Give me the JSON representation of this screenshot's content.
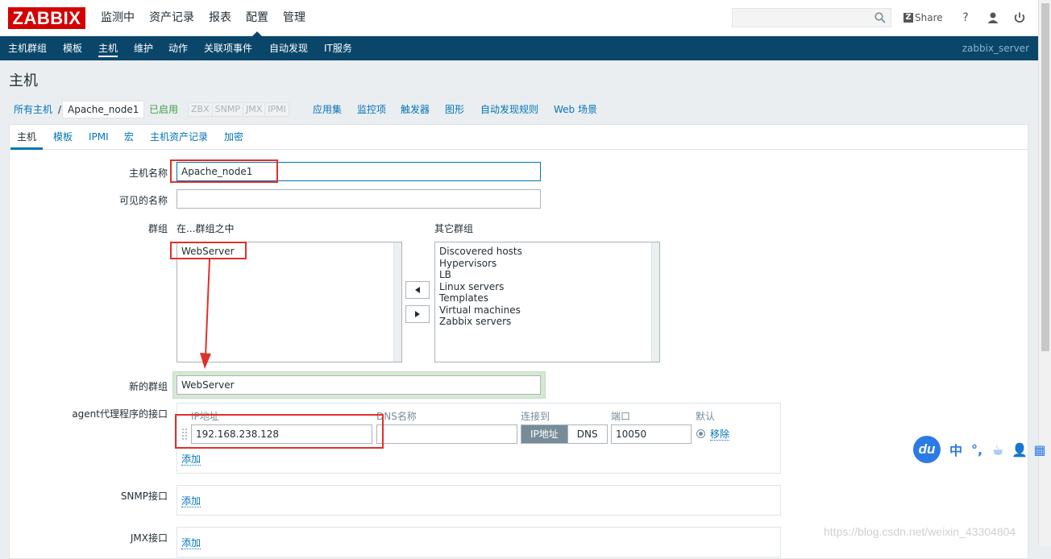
{
  "logo": "ZABBIX",
  "main_menu": [
    "监测中",
    "资产记录",
    "报表",
    "配置",
    "管理"
  ],
  "main_menu_active": "配置",
  "search": {
    "value": "",
    "placeholder": ""
  },
  "header_tools": {
    "share": "Share",
    "help": "?"
  },
  "sub_menu": [
    "主机群组",
    "模板",
    "主机",
    "维护",
    "动作",
    "关联项事件",
    "自动发现",
    "IT服务"
  ],
  "sub_menu_active": "主机",
  "server_name": "zabbix_server",
  "page_title": "主机",
  "breadcrumb": {
    "all_hosts": "所有主机",
    "separator": "/",
    "current": "Apache_node1",
    "status": "已启用",
    "availability": [
      "ZBX",
      "SNMP",
      "JMX",
      "IPMI"
    ],
    "links": [
      "应用集",
      "监控项",
      "触发器",
      "图形",
      "自动发现规则",
      "Web 场景"
    ]
  },
  "tabs": [
    "主机",
    "模板",
    "IPMI",
    "宏",
    "主机资产记录",
    "加密"
  ],
  "tab_active": "主机",
  "form": {
    "host_name_label": "主机名称",
    "host_name_value": "Apache_node1",
    "visible_name_label": "可见的名称",
    "visible_name_value": "",
    "groups_label": "群组",
    "in_groups_label": "在...群组之中",
    "other_groups_label": "其它群组",
    "in_groups": [
      "WebServer"
    ],
    "other_groups": [
      "Discovered hosts",
      "Hypervisors",
      "LB",
      "Linux servers",
      "Templates",
      "Virtual machines",
      "Zabbix servers"
    ],
    "new_group_label": "新的群组",
    "new_group_value": "WebServer",
    "agent_label": "agent代理程序的接口",
    "agent_columns": {
      "ip": "IP地址",
      "dns": "DNS名称",
      "connect": "连接到",
      "port": "端口",
      "default": "默认"
    },
    "agent_row": {
      "ip": "192.168.238.128",
      "dns": "",
      "connect_ip": "IP地址",
      "connect_dns": "DNS",
      "port": "10050",
      "remove": "移除"
    },
    "add_label": "添加",
    "snmp_label": "SNMP接口",
    "jmx_label": "JMX接口"
  },
  "ime_bar": {
    "logo": "du",
    "tools": [
      "中",
      "°,",
      "☕",
      "👤",
      "▦"
    ]
  },
  "watermark": "https://blog.csdn.net/weixin_43304804",
  "colors": {
    "brand": "#d40000",
    "nav": "#0a466a",
    "link": "#0275b8",
    "enabled": "#429e47",
    "annotation": "#e0302b"
  }
}
